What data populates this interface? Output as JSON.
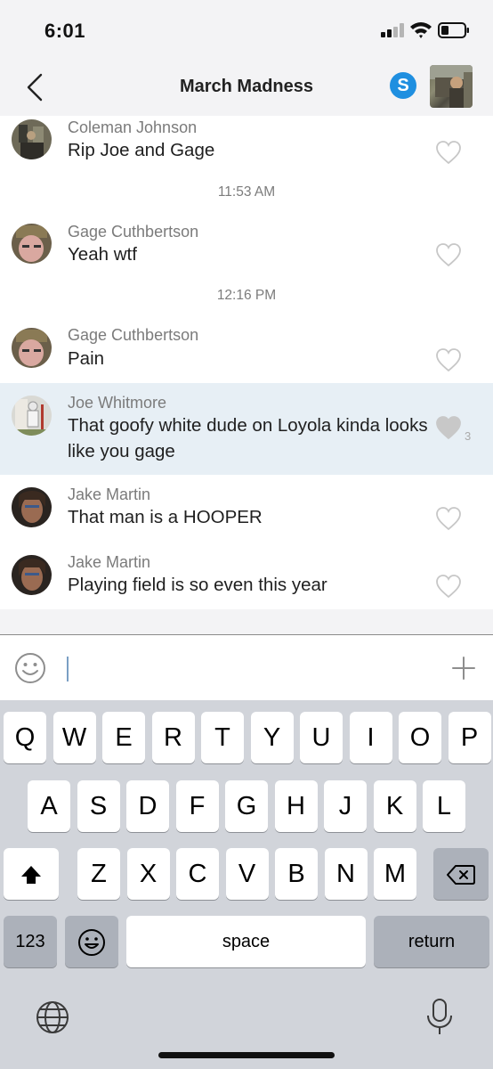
{
  "status_bar": {
    "time": "6:01"
  },
  "header": {
    "title": "March Madness",
    "skype_label": "S"
  },
  "messages": [
    {
      "sender": "Coleman Johnson",
      "text": "Rip Joe and Gage",
      "likes": ""
    },
    {
      "sender": "Gage Cuthbertson",
      "text": "Yeah wtf",
      "likes": ""
    },
    {
      "sender": "Gage Cuthbertson",
      "text": "Pain",
      "likes": ""
    },
    {
      "sender": "Joe Whitmore",
      "text": "That goofy white dude on Loyola kinda looks like you gage",
      "likes": "3"
    },
    {
      "sender": "Jake Martin",
      "text": "That man is a HOOPER",
      "likes": ""
    },
    {
      "sender": "Jake Martin",
      "text": "Playing field is so even this year",
      "likes": ""
    }
  ],
  "timestamps": [
    "11:53 AM",
    "12:16 PM"
  ],
  "keyboard": {
    "row1": [
      "Q",
      "W",
      "E",
      "R",
      "T",
      "Y",
      "U",
      "I",
      "O",
      "P"
    ],
    "row2": [
      "A",
      "S",
      "D",
      "F",
      "G",
      "H",
      "J",
      "K",
      "L"
    ],
    "row3": [
      "Z",
      "X",
      "C",
      "V",
      "B",
      "N",
      "M"
    ],
    "numbers_label": "123",
    "space_label": "space",
    "return_label": "return"
  },
  "colors": {
    "highlight_row": "#e7eff5",
    "skype_blue": "#1f8fe0",
    "keyboard_bg": "#d1d4da",
    "key_dark": "#acb1ba"
  }
}
